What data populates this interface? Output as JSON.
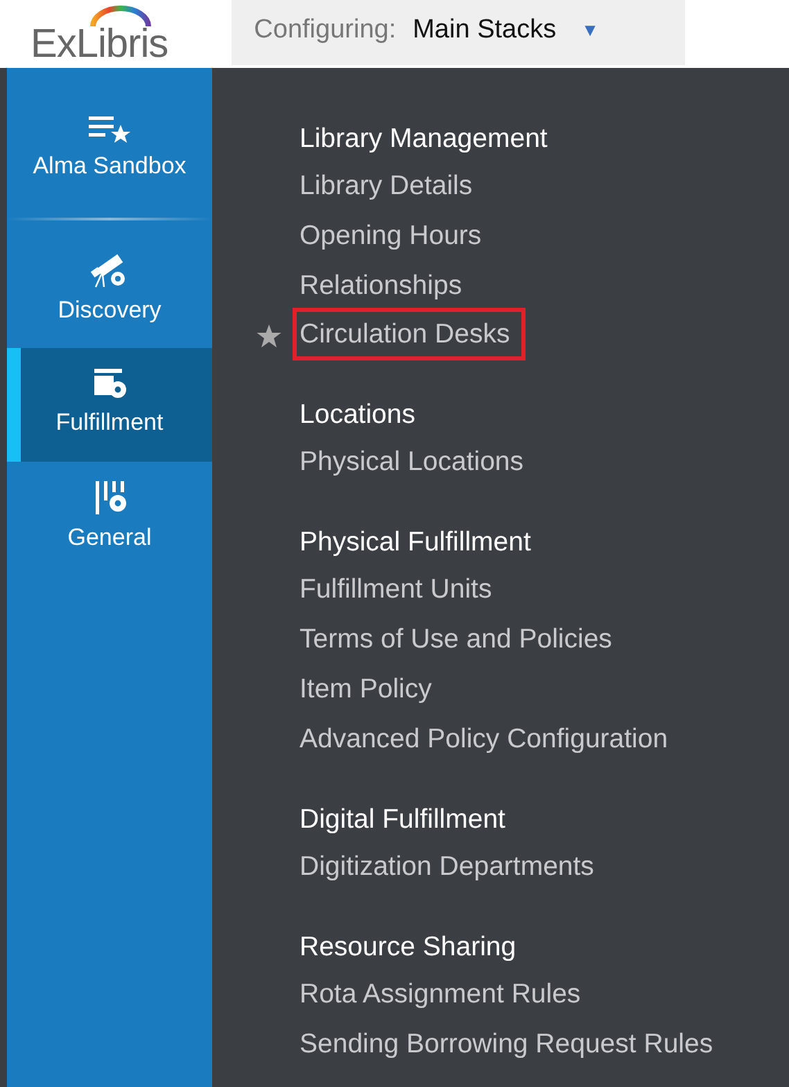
{
  "header": {
    "logo": "ExLibris",
    "configuring_label": "Configuring:",
    "configuring_value": "Main Stacks",
    "dropdown_caret": "▼"
  },
  "sidebar": {
    "items": [
      {
        "label": "Alma Sandbox",
        "selected": false
      },
      {
        "label": "Discovery",
        "selected": false
      },
      {
        "label": "Fulfillment",
        "selected": true
      },
      {
        "label": "General",
        "selected": false
      }
    ]
  },
  "menu": {
    "sections": [
      {
        "title": "Library Management",
        "items": [
          {
            "label": "Library Details",
            "starred": false,
            "highlighted": false
          },
          {
            "label": "Opening Hours",
            "starred": false,
            "highlighted": false
          },
          {
            "label": "Relationships",
            "starred": false,
            "highlighted": false
          },
          {
            "label": "Circulation Desks",
            "starred": true,
            "highlighted": true
          }
        ]
      },
      {
        "title": "Locations",
        "items": [
          {
            "label": "Physical Locations",
            "starred": false,
            "highlighted": false
          }
        ]
      },
      {
        "title": "Physical Fulfillment",
        "items": [
          {
            "label": "Fulfillment Units",
            "starred": false,
            "highlighted": false
          },
          {
            "label": "Terms of Use and Policies",
            "starred": false,
            "highlighted": false
          },
          {
            "label": "Item Policy",
            "starred": false,
            "highlighted": false
          },
          {
            "label": "Advanced Policy Configuration",
            "starred": false,
            "highlighted": false
          }
        ]
      },
      {
        "title": "Digital Fulfillment",
        "items": [
          {
            "label": "Digitization Departments",
            "starred": false,
            "highlighted": false
          }
        ]
      },
      {
        "title": "Resource Sharing",
        "items": [
          {
            "label": "Rota Assignment Rules",
            "starred": false,
            "highlighted": false
          },
          {
            "label": "Sending Borrowing Request Rules",
            "starred": false,
            "highlighted": false
          }
        ]
      }
    ]
  }
}
